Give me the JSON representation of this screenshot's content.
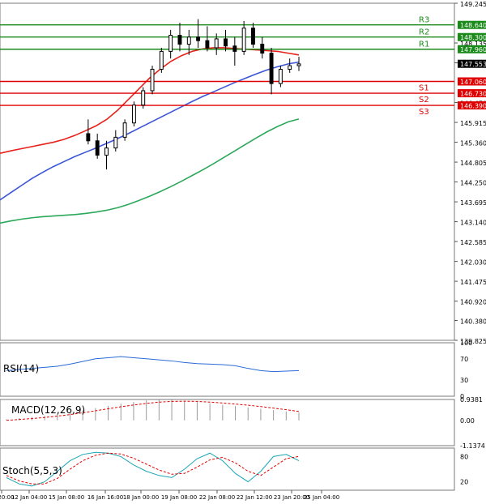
{
  "chart_data": {
    "type": "candlestick",
    "title": "",
    "x_ticks": [
      "an 20:00",
      "12 Jan 04:00",
      "15 Jan 08:00",
      "16 Jan 16:00",
      "18 Jan 00:00",
      "19 Jan 08:00",
      "22 Jan 08:00",
      "22 Jan 12:00",
      "23 Jan 20:00",
      "25 Jan 04:00"
    ],
    "price_ticks": [
      "149.245",
      "148.135",
      "147.580",
      "146.470",
      "145.915",
      "145.360",
      "144.805",
      "144.250",
      "143.695",
      "143.140",
      "142.585",
      "142.030",
      "141.475",
      "140.920",
      "140.380",
      "139.825"
    ],
    "ylim": [
      139.825,
      149.245
    ],
    "current_price": 147.553,
    "levels": [
      {
        "name": "R3",
        "value": 148.64,
        "value_label": "148.640",
        "color": "#1a8a1a"
      },
      {
        "name": "R2",
        "value": 148.3,
        "value_label": "148.300",
        "color": "#1a8a1a"
      },
      {
        "name": "R1",
        "value": 147.96,
        "value_label": "147.960",
        "color": "#1a8a1a"
      },
      {
        "name": "S1",
        "value": 147.06,
        "value_label": "147.060",
        "color": "#e00000"
      },
      {
        "name": "S2",
        "value": 146.73,
        "value_label": "146.730",
        "color": "#e00000"
      },
      {
        "name": "S3",
        "value": 146.39,
        "value_label": "146.390",
        "color": "#e00000"
      }
    ],
    "moving_averages": [
      {
        "color": "#e8201a",
        "values": [
          145.05,
          145.12,
          145.18,
          145.24,
          145.3,
          145.36,
          145.44,
          145.55,
          145.68,
          145.82,
          146.0,
          146.25,
          146.55,
          146.85,
          147.15,
          147.4,
          147.62,
          147.78,
          147.9,
          147.97,
          148.0,
          148.0,
          147.98,
          147.96,
          147.94,
          147.92,
          147.9,
          147.85,
          147.8
        ]
      },
      {
        "color": "#3b55d9",
        "values": [
          143.75,
          143.95,
          144.15,
          144.35,
          144.52,
          144.68,
          144.82,
          144.96,
          145.08,
          145.2,
          145.33,
          145.46,
          145.6,
          145.75,
          145.9,
          146.05,
          146.2,
          146.35,
          146.5,
          146.64,
          146.77,
          146.9,
          147.03,
          147.15,
          147.27,
          147.38,
          147.47,
          147.55,
          147.6
        ]
      },
      {
        "color": "#2ca85a",
        "values": [
          143.1,
          143.16,
          143.21,
          143.25,
          143.28,
          143.3,
          143.32,
          143.34,
          143.37,
          143.41,
          143.46,
          143.53,
          143.62,
          143.73,
          143.85,
          143.98,
          144.12,
          144.27,
          144.43,
          144.59,
          144.76,
          144.94,
          145.12,
          145.3,
          145.48,
          145.65,
          145.8,
          145.93,
          146.01
        ]
      }
    ],
    "candles": [
      {
        "o": 145.6,
        "h": 146.0,
        "l": 145.3,
        "c": 145.4
      },
      {
        "o": 145.4,
        "h": 145.6,
        "l": 144.9,
        "c": 145.0
      },
      {
        "o": 145.0,
        "h": 145.4,
        "l": 144.6,
        "c": 145.2
      },
      {
        "o": 145.2,
        "h": 145.7,
        "l": 145.1,
        "c": 145.5
      },
      {
        "o": 145.5,
        "h": 146.0,
        "l": 145.4,
        "c": 145.9
      },
      {
        "o": 145.9,
        "h": 146.5,
        "l": 145.8,
        "c": 146.4
      },
      {
        "o": 146.4,
        "h": 146.9,
        "l": 146.3,
        "c": 146.8
      },
      {
        "o": 146.8,
        "h": 147.5,
        "l": 146.7,
        "c": 147.4
      },
      {
        "o": 147.4,
        "h": 148.0,
        "l": 147.3,
        "c": 147.9
      },
      {
        "o": 147.9,
        "h": 148.5,
        "l": 147.7,
        "c": 148.35
      },
      {
        "o": 148.35,
        "h": 148.7,
        "l": 147.9,
        "c": 148.1
      },
      {
        "o": 148.1,
        "h": 148.5,
        "l": 147.8,
        "c": 148.3
      },
      {
        "o": 148.3,
        "h": 148.8,
        "l": 148.0,
        "c": 148.2
      },
      {
        "o": 148.2,
        "h": 148.6,
        "l": 147.9,
        "c": 148.0
      },
      {
        "o": 148.0,
        "h": 148.4,
        "l": 147.8,
        "c": 148.25
      },
      {
        "o": 148.25,
        "h": 148.5,
        "l": 147.9,
        "c": 148.05
      },
      {
        "o": 148.05,
        "h": 148.3,
        "l": 147.5,
        "c": 147.9
      },
      {
        "o": 147.9,
        "h": 148.75,
        "l": 147.8,
        "c": 148.55
      },
      {
        "o": 148.55,
        "h": 148.7,
        "l": 148.0,
        "c": 148.1
      },
      {
        "o": 148.1,
        "h": 148.3,
        "l": 147.7,
        "c": 147.85
      },
      {
        "o": 147.85,
        "h": 148.0,
        "l": 146.7,
        "c": 147.0
      },
      {
        "o": 147.0,
        "h": 147.5,
        "l": 146.9,
        "c": 147.4
      },
      {
        "o": 147.4,
        "h": 147.7,
        "l": 147.3,
        "c": 147.5
      },
      {
        "o": 147.5,
        "h": 147.75,
        "l": 147.35,
        "c": 147.55
      }
    ],
    "indicators": [
      {
        "name": "RSI(14)",
        "ticks": [
          "100",
          "70",
          "30",
          "0"
        ]
      },
      {
        "name": "MACD(12,26,9)",
        "ticks": [
          "0.9381",
          "0.00",
          "-1.1374"
        ]
      },
      {
        "name": "Stoch(5,5,3)",
        "ticks": [
          "80",
          "20"
        ]
      }
    ],
    "rsi": [
      48,
      50,
      52,
      54,
      56,
      60,
      65,
      70,
      72,
      74,
      72,
      70,
      68,
      66,
      63,
      61,
      60,
      59,
      57,
      52,
      48,
      46,
      47,
      48
    ],
    "macd_hist": [
      0.05,
      0.1,
      0.15,
      0.2,
      0.28,
      0.36,
      0.45,
      0.55,
      0.65,
      0.75,
      0.83,
      0.9,
      0.93,
      0.92,
      0.88,
      0.82,
      0.76,
      0.7,
      0.64,
      0.58,
      0.52,
      0.46,
      0.4,
      0.35
    ],
    "macd_signal": [
      0.0,
      0.04,
      0.08,
      0.13,
      0.19,
      0.26,
      0.34,
      0.43,
      0.52,
      0.61,
      0.69,
      0.76,
      0.82,
      0.85,
      0.86,
      0.85,
      0.82,
      0.78,
      0.73,
      0.68,
      0.62,
      0.55,
      0.48,
      0.4
    ],
    "stoch_k": [
      30,
      15,
      10,
      20,
      45,
      70,
      85,
      90,
      88,
      80,
      60,
      45,
      35,
      30,
      50,
      75,
      88,
      70,
      40,
      20,
      45,
      80,
      85,
      70
    ],
    "stoch_d": [
      35,
      22,
      15,
      15,
      28,
      50,
      70,
      83,
      88,
      86,
      76,
      62,
      48,
      38,
      40,
      55,
      72,
      78,
      65,
      45,
      35,
      55,
      75,
      80
    ]
  }
}
